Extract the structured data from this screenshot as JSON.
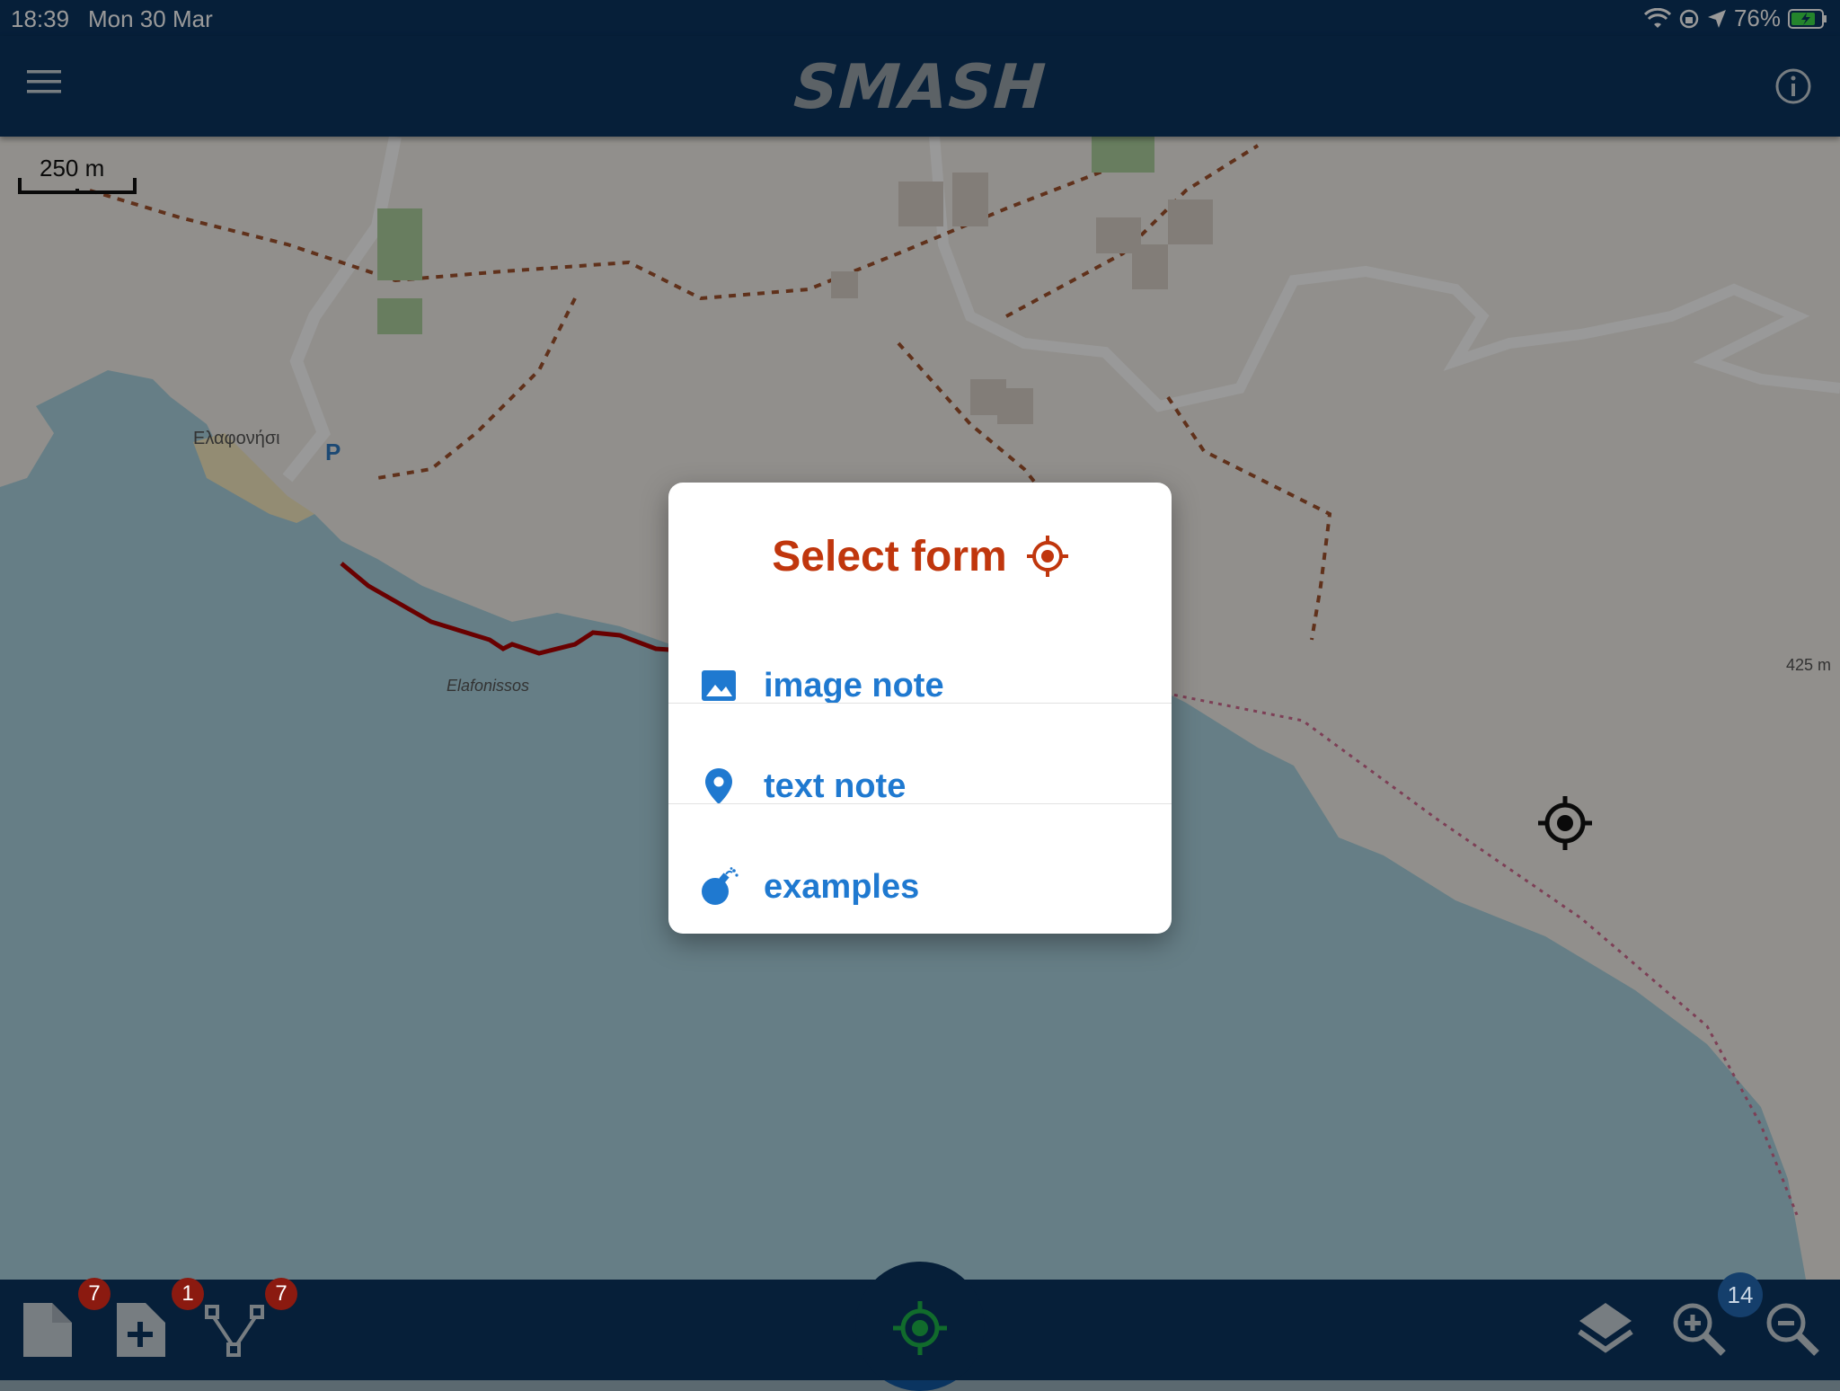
{
  "status_bar": {
    "time": "18:39",
    "date": "Mon 30 Mar",
    "battery": "76%"
  },
  "app_bar": {
    "title": "SMASH",
    "menu_icon": "hamburger-menu-icon",
    "info_icon": "info-icon"
  },
  "map": {
    "scale_label": "250 m",
    "place_labels": [
      "Ελαφονήσι",
      "Elafonissos",
      "425 m"
    ],
    "colors": {
      "sea": "#aad3df",
      "land": "#f2efe9",
      "track": "#b00000",
      "path": "#a0522d"
    }
  },
  "dialog": {
    "title": "Select form",
    "title_icon": "gps-target-icon",
    "title_color": "#c0360d",
    "items": [
      {
        "label": "image note",
        "icon": "image-icon"
      },
      {
        "label": "text note",
        "icon": "map-pin-icon"
      },
      {
        "label": "examples",
        "icon": "bomb-icon"
      }
    ],
    "item_color": "#1f79d0"
  },
  "bottom_bar": {
    "notes_badge": "7",
    "add_note_badge": "1",
    "logs_badge": "7",
    "zoom_level": "14",
    "gps_color": "#1db34a"
  }
}
